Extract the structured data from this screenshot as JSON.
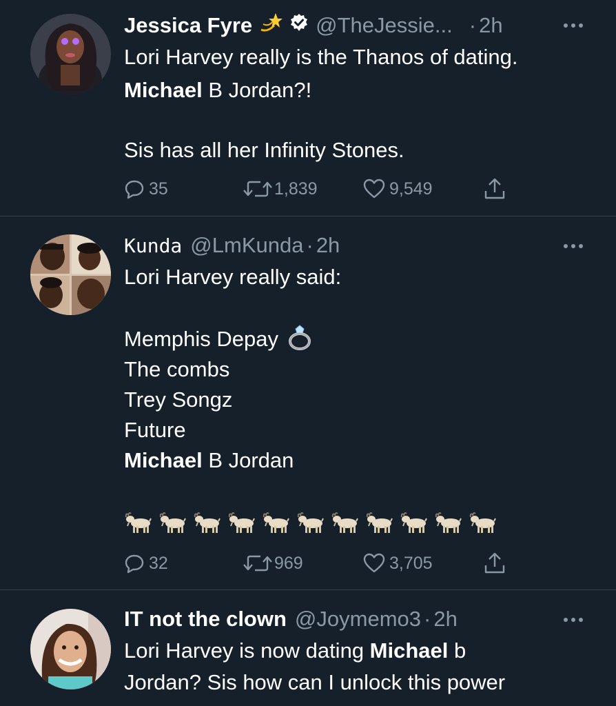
{
  "tweets": [
    {
      "display_name": "Jessica Fyre",
      "name_emoji": "dizzy-star-emoji",
      "verified": true,
      "handle": "@TheJessie...",
      "dot": "·",
      "time": "2h",
      "lines": [
        [
          {
            "text": "Lori Harvey really is the Thanos of dating.",
            "bold": false
          }
        ],
        [
          {
            "text": "Michael",
            "bold": true
          },
          {
            "text": " B Jordan?!",
            "bold": false
          }
        ],
        [],
        [
          {
            "text": "Sis has all her Infinity Stones.",
            "bold": false
          }
        ]
      ],
      "replies": "35",
      "retweets": "1,839",
      "likes": "9,549"
    },
    {
      "display_name": "Kunda",
      "handle": "@LmKunda",
      "dot": "·",
      "time": "2h",
      "lines": [
        [
          {
            "text": "Lori Harvey really said:",
            "bold": false
          }
        ],
        [],
        [
          {
            "text": "Memphis Depay",
            "bold": false
          }
        ],
        [
          {
            "text": "The combs",
            "bold": false
          }
        ],
        [
          {
            "text": "Trey Songz",
            "bold": false
          }
        ],
        [
          {
            "text": "Future",
            "bold": false
          }
        ],
        [
          {
            "text": "Michael",
            "bold": true
          },
          {
            "text": " B Jordan",
            "bold": false
          }
        ]
      ],
      "ring_emoji": "ring-emoji",
      "goat_count": 11,
      "goat_emoji": "goat-emoji",
      "replies": "32",
      "retweets": "969",
      "likes": "3,705"
    },
    {
      "display_name": "IT not the clown",
      "handle": "@Joymemo3",
      "dot": "·",
      "time": "2h",
      "lines": [
        [
          {
            "text": "Lori Harvey is now dating ",
            "bold": false
          },
          {
            "text": "Michael",
            "bold": true
          },
          {
            "text": " b",
            "bold": false
          }
        ],
        [
          {
            "text": "Jordan? Sis how can I unlock this power",
            "bold": false
          }
        ]
      ]
    }
  ],
  "colors": {
    "background": "#15202b",
    "secondary_text": "#8b98a5",
    "divider": "#38444d",
    "primary_text": "#ffffff"
  }
}
